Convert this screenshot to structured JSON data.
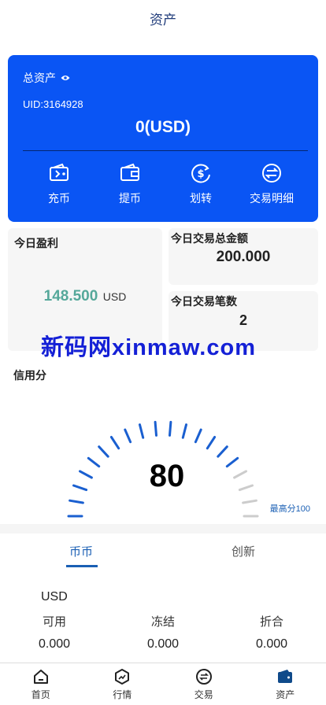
{
  "header": {
    "title": "资产"
  },
  "asset_card": {
    "label": "总资产",
    "uid": "UID:3164928",
    "total": "0(USD)",
    "actions": [
      {
        "icon": "wallet-deposit-icon",
        "label": "充币"
      },
      {
        "icon": "wallet-withdraw-icon",
        "label": "提币"
      },
      {
        "icon": "dollar-transfer-icon",
        "label": "划转"
      },
      {
        "icon": "exchange-icon",
        "label": "交易明细"
      }
    ]
  },
  "stats": {
    "profit_label": "今日盈利",
    "profit_value": "148.500",
    "profit_unit": "USD",
    "volume_label": "今日交易总金额",
    "volume_value": "200.000",
    "count_label": "今日交易笔数",
    "count_value": "2"
  },
  "watermark": "新码网xinmaw.com",
  "credit": {
    "label": "信用分",
    "score": "80",
    "max_label": "最高分100",
    "level": 0.8,
    "active_color": "#1a5fd0",
    "inactive_color": "#cccccc"
  },
  "tabs": {
    "active": "币币",
    "inactive": "创新"
  },
  "balance": {
    "currency": "USD",
    "columns": [
      {
        "label": "可用",
        "value": "0.000"
      },
      {
        "label": "冻结",
        "value": "0.000"
      },
      {
        "label": "折合",
        "value": "0.000"
      }
    ]
  },
  "bottom_nav": [
    {
      "icon": "home-icon",
      "label": "首页"
    },
    {
      "icon": "market-icon",
      "label": "行情"
    },
    {
      "icon": "trade-icon",
      "label": "交易"
    },
    {
      "icon": "wallet-icon",
      "label": "资产"
    }
  ],
  "colors": {
    "brand": "#0a55f4",
    "accent": "#1a5fb4",
    "profit": "#55a89a"
  }
}
